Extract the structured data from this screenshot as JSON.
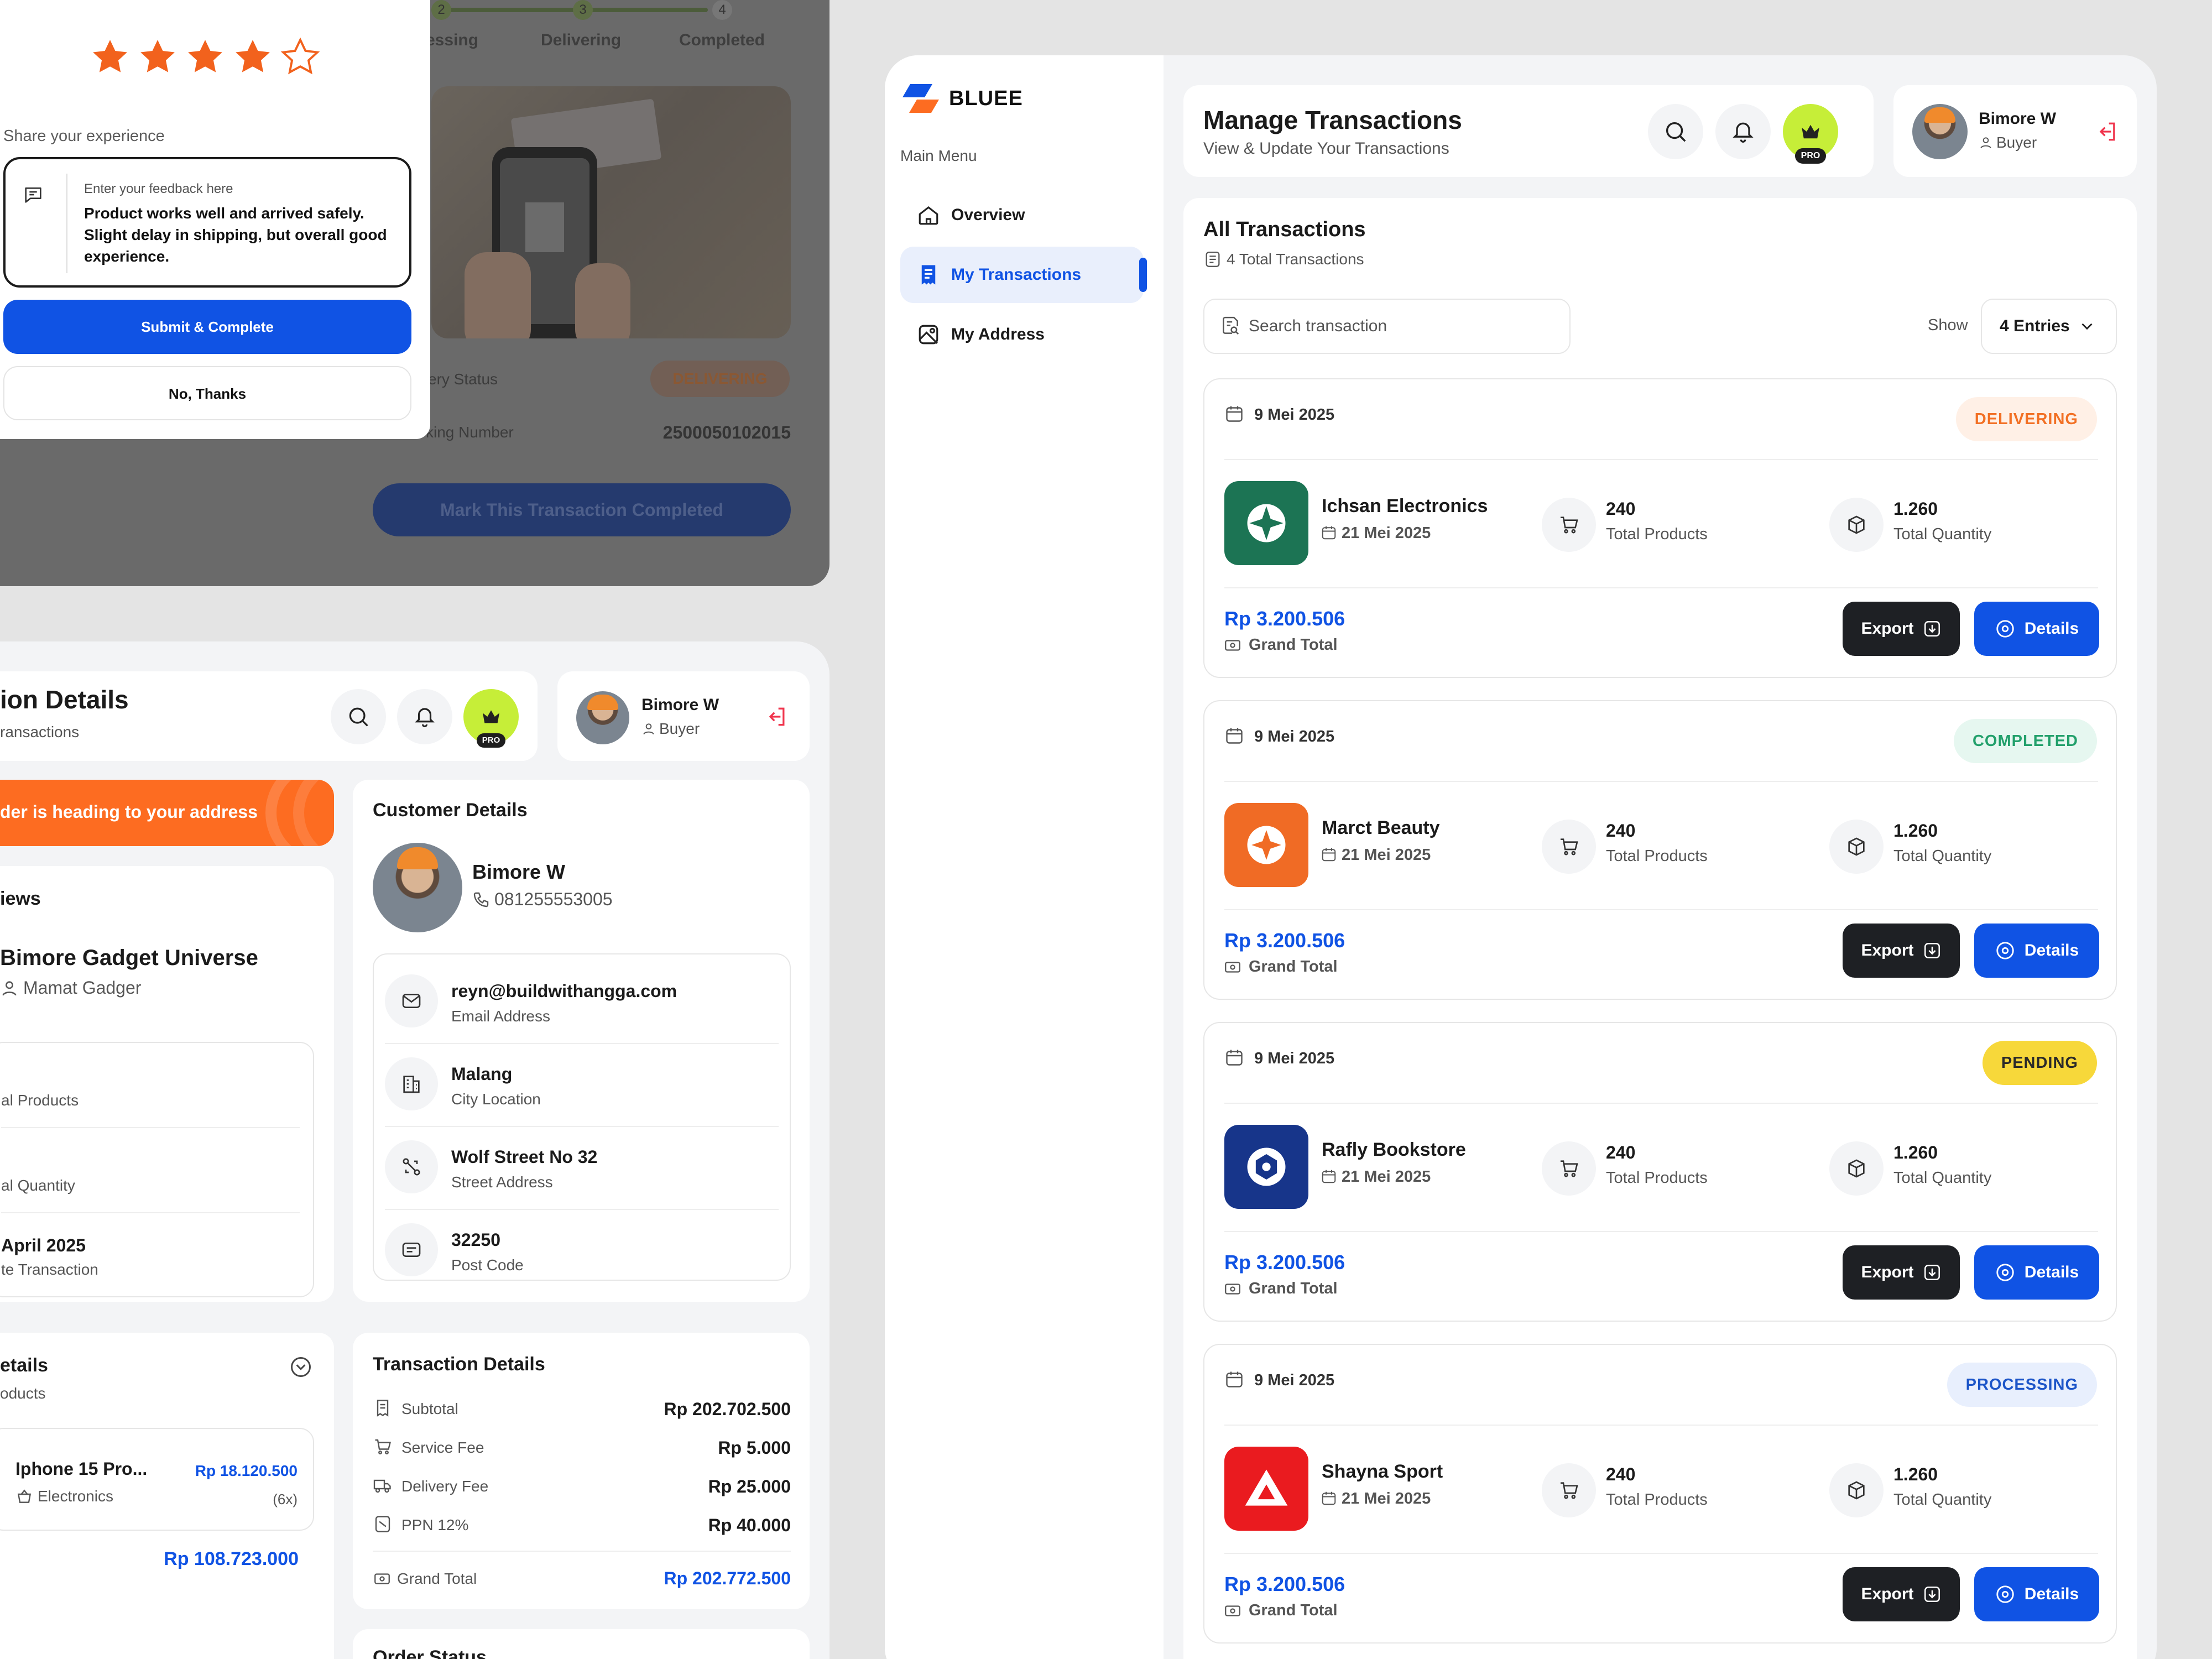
{
  "colors": {
    "primary": "#1053e4",
    "orange": "#fd6c21",
    "dark": "#1e2024",
    "lime": "#c6ee38",
    "red": "#f0344c"
  },
  "modal": {
    "rating": 4,
    "max_rating": 5,
    "share_label": "Share your experience",
    "feedback_placeholder": "Enter your feedback here",
    "feedback_value": "Product works well and arrived safely. Slight delay in shipping, but overall good experience.",
    "submit_label": "Submit & Complete",
    "cancel_label": "No, Thanks"
  },
  "tracking_bg": {
    "steps": [
      {
        "num": "2",
        "label": "Processing",
        "visible": "essing"
      },
      {
        "num": "3",
        "label": "Delivering"
      },
      {
        "num": "4",
        "label": "Completed"
      }
    ],
    "delivery_status_label": "very Status",
    "delivery_status_value": "DELIVERING",
    "tracking_label": "king Number",
    "tracking_value": "2500050102015",
    "complete_button": "Mark This Transaction Completed"
  },
  "sidebar": {
    "brand": "BLUEE",
    "menu_label": "Main Menu",
    "items": [
      {
        "label": "Overview",
        "icon": "home-icon",
        "active": false
      },
      {
        "label": "My Transactions",
        "icon": "receipt-icon",
        "active": true
      },
      {
        "label": "My Address",
        "icon": "map-icon",
        "active": false
      }
    ]
  },
  "header": {
    "title": "Manage Transactions",
    "subtitle": "View & Update Your Transactions",
    "pro_badge": "PRO",
    "user_name": "Bimore W",
    "user_role": "Buyer"
  },
  "transactions": {
    "title": "All Transactions",
    "count_text": "4 Total Transactions",
    "search_placeholder": "Search transaction",
    "show_label": "Show",
    "entries_value": "4 Entries",
    "export_label": "Export",
    "details_label": "Details",
    "products_label": "Total Products",
    "quantity_label": "Total Quantity",
    "grand_total_label": "Grand Total",
    "items": [
      {
        "date": "9 Mei 2025",
        "status": "DELIVERING",
        "status_fg": "#f27024",
        "status_bg": "#fff0e6",
        "store": "Ichsan Electronics",
        "store_date": "21 Mei 2025",
        "logo_color": "#1c7454",
        "logo": "sparkle",
        "products": "240",
        "quantity": "1.260",
        "total": "Rp 3.200.506"
      },
      {
        "date": "9 Mei 2025",
        "status": "COMPLETED",
        "status_fg": "#22a06b",
        "status_bg": "#e6f7f0",
        "store": "Marct Beauty",
        "store_date": "21 Mei 2025",
        "logo_color": "#f06b25",
        "logo": "star",
        "products": "240",
        "quantity": "1.260",
        "total": "Rp 3.200.506"
      },
      {
        "date": "9 Mei 2025",
        "status": "PENDING",
        "status_fg": "#2a2a2a",
        "status_bg": "#f7d83a",
        "store": "Rafly Bookstore",
        "store_date": "21 Mei 2025",
        "logo_color": "#17358a",
        "logo": "aperture",
        "products": "240",
        "quantity": "1.260",
        "total": "Rp 3.200.506"
      },
      {
        "date": "9 Mei 2025",
        "status": "PROCESSING",
        "status_fg": "#1c55c8",
        "status_bg": "#e8effd",
        "store": "Shayna Sport",
        "store_date": "21 Mei 2025",
        "logo_color": "#ea1b1f",
        "logo": "triangle",
        "products": "240",
        "quantity": "1.260",
        "total": "Rp 3.200.506"
      }
    ]
  },
  "detail_page": {
    "title": "ion Details",
    "subtitle": "ransactions",
    "user_name": "Bimore W",
    "user_role": "Buyer",
    "banner": "der is heading to your address",
    "reviews_title": "iews",
    "store_name": "Bimore Gadget Universe",
    "store_owner": "Mamat Gadger",
    "stats": [
      {
        "value": "",
        "label": "al Products"
      },
      {
        "value": "",
        "label": "al Quantity"
      },
      {
        "value": "April 2025",
        "label": "te Transaction"
      }
    ],
    "customer": {
      "title": "Customer Details",
      "name": "Bimore W",
      "phone": "081255553005",
      "rows": [
        {
          "value": "reyn@buildwithangga.com",
          "label": "Email Address",
          "icon": "mail-icon"
        },
        {
          "value": "Malang",
          "label": "City Location",
          "icon": "building-icon"
        },
        {
          "value": "Wolf Street No 32",
          "label": "Street Address",
          "icon": "route-icon"
        },
        {
          "value": "32250",
          "label": "Post Code",
          "icon": "postcode-icon"
        }
      ]
    },
    "product_details": {
      "title": "etails",
      "subtitle": "oducts",
      "product_name": "Iphone 15 Pro...",
      "product_category": "Electronics",
      "product_price": "Rp 18.120.500",
      "product_qty": "(6x)",
      "total": "Rp 108.723.000"
    },
    "transaction_details": {
      "title": "Transaction Details",
      "rows": [
        {
          "label": "Subtotal",
          "value": "Rp 202.702.500"
        },
        {
          "label": "Service Fee",
          "value": "Rp 5.000"
        },
        {
          "label": "Delivery Fee",
          "value": "Rp 25.000"
        },
        {
          "label": "PPN 12%",
          "value": "Rp 40.000"
        }
      ],
      "grand_label": "Grand Total",
      "grand_value": "Rp 202.772.500"
    },
    "order_status_title": "Order Status"
  }
}
